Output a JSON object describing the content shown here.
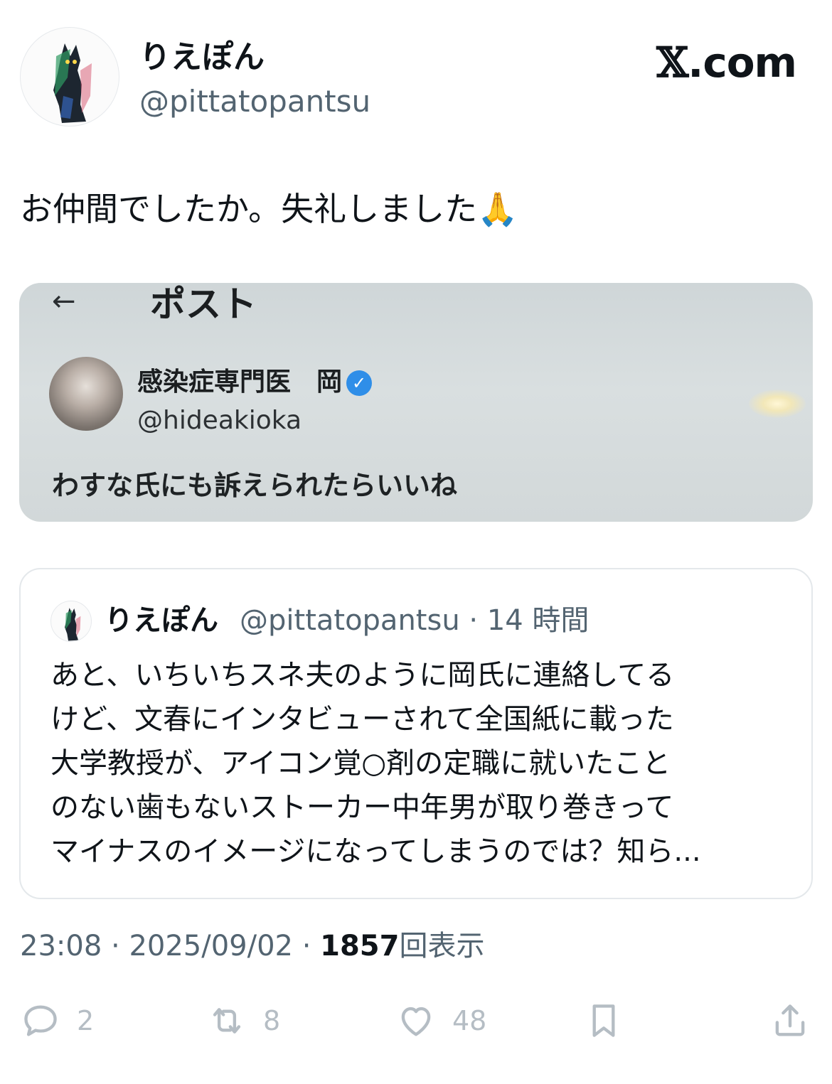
{
  "header": {
    "name": "りえぽん",
    "handle": "@pittatopantsu",
    "brand_x": "𝕏",
    "brand_domain": ".com"
  },
  "tweet": {
    "text": "お仲間でしたか。失礼しました🙏"
  },
  "media": {
    "back_arrow": "←",
    "title": "ポスト",
    "author_name": "感染症専門医　岡",
    "verified_icon": "✓",
    "author_handle": "@hideakioka",
    "post_text": "わすな氏にも訴えられたらいいね"
  },
  "quote": {
    "name": "りえぽん",
    "handle_time": "@pittatopantsu · 14 時間",
    "lines": [
      "あと、いちいちスネ夫のように岡氏に連絡してる",
      "けど、文春にインタビューされて全国紙に載った",
      "大学教授が、アイコン覚○剤の定職に就いたこと",
      "のない歯もないストーカー中年男が取り巻きって",
      "マイナスのイメージになってしまうのでは？知ら..."
    ]
  },
  "meta": {
    "time": "23:08",
    "date": "2025/09/02",
    "separator": "·",
    "views_count": "1857",
    "views_label": "回表示"
  },
  "actions": {
    "reply_count": "2",
    "retweet_count": "8",
    "like_count": "48"
  },
  "colors": {
    "text": "#0f1419",
    "secondary": "#536471",
    "action_icon": "#b5bdc4",
    "verified": "#2f8ee8"
  }
}
